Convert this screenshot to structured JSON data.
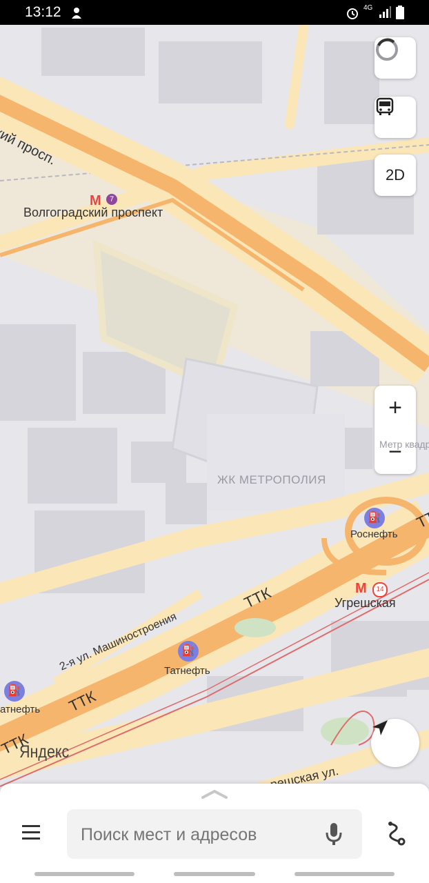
{
  "status_bar": {
    "time": "13:12",
    "network": "4G"
  },
  "map": {
    "labels": {
      "avenue_short": "ский просп.",
      "metro_volgogradsky": "Волгоградский проспект",
      "metro_volgogradsky_line": "7",
      "jk_metropolia": "ЖК МЕТРОПОЛИЯ",
      "rosneft": "Роснефть",
      "ugreshskaya": "Угрешская",
      "ugreshskaya_line": "14",
      "ttk_1": "ТТК",
      "ttk_2": "ТТК",
      "ttk_3": "ТТК",
      "ttk_4": "ТТК",
      "mashinostroeniya": "2-я ул. Машиностроения",
      "tatneft_1": "Татнефть",
      "tatneft_2": "атнефть",
      "ugreshskaya_street": "решская ул.",
      "metr_kvadrat": "Метр квадр",
      "yandex": "Яндекс"
    },
    "controls": {
      "mode_2d": "2D",
      "zoom_in": "+",
      "zoom_out": "−"
    }
  },
  "search": {
    "placeholder": "Поиск мест и адресов"
  },
  "icons": [
    "alice-icon",
    "transport-bus-icon",
    "locate-icon",
    "menu-icon",
    "microphone-icon",
    "route-icon",
    "metro-icon",
    "fuel-icon",
    "alarm-icon"
  ],
  "colors": {
    "major_road": "#f6b56c",
    "road_fill": "#fbe6b7",
    "building": "#d7d6dc",
    "metro": "#f0413a",
    "line7": "#8e479c",
    "poi": "#7c7fe0"
  }
}
